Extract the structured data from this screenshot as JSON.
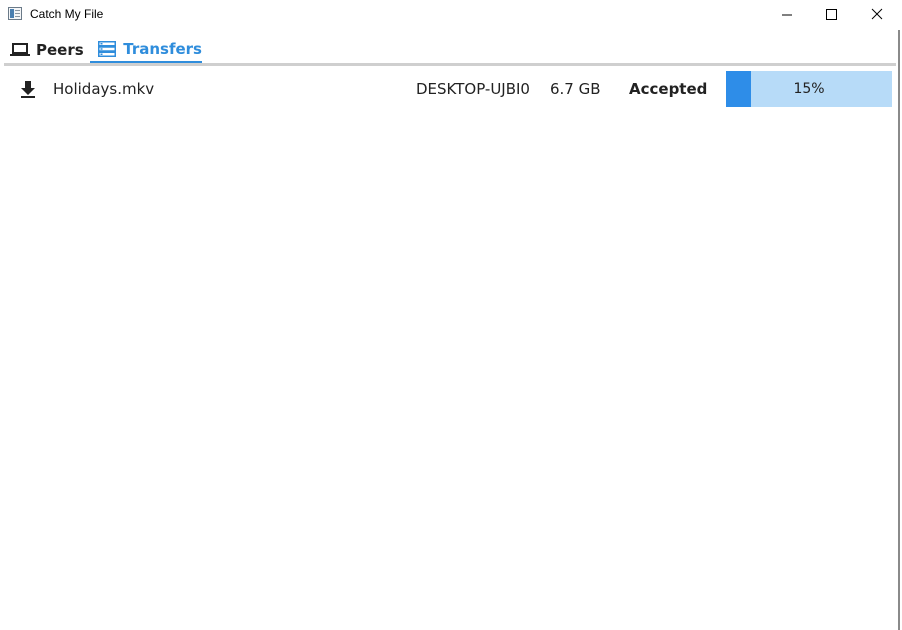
{
  "window": {
    "title": "Catch My File"
  },
  "tabs": [
    {
      "label": "Peers",
      "icon": "laptop-icon",
      "active": false
    },
    {
      "label": "Transfers",
      "icon": "list-icon",
      "active": true
    }
  ],
  "colors": {
    "accent": "#2f8ddc",
    "progress_fill": "#2e8de8",
    "progress_track": "#b7dbf8"
  },
  "transfers": [
    {
      "direction_icon": "download-icon",
      "file_name": "Holidays.mkv",
      "peer": "DESKTOP-UJBI0",
      "size": "6.7 GB",
      "status": "Accepted",
      "progress": 15,
      "progress_label": "15%"
    }
  ]
}
